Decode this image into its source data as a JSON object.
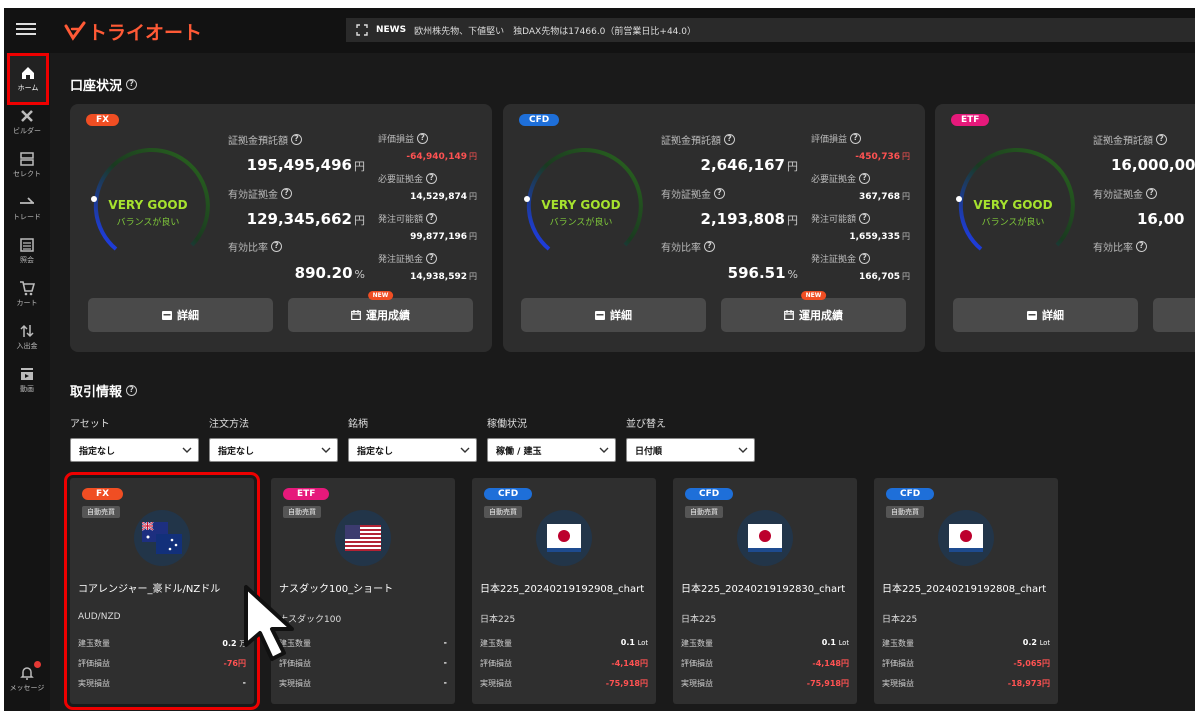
{
  "header": {
    "menu_icon": "hamburger-icon",
    "logo_text": "トライオート",
    "news": {
      "label": "NEWS",
      "text": "欧州株先物、下値堅い　独DAX先物は17466.0（前営業日比+44.0）"
    }
  },
  "sidebar": {
    "items": [
      {
        "label": "ホーム",
        "icon": "home-icon"
      },
      {
        "label": "ビルダー",
        "icon": "tools-icon"
      },
      {
        "label": "セレクト",
        "icon": "select-icon"
      },
      {
        "label": "トレード",
        "icon": "trade-icon"
      },
      {
        "label": "照会",
        "icon": "list-icon"
      },
      {
        "label": "カート",
        "icon": "cart-icon"
      },
      {
        "label": "入出金",
        "icon": "transfer-icon"
      },
      {
        "label": "動画",
        "icon": "video-icon"
      },
      {
        "label": "メッセージ",
        "icon": "bell-icon"
      }
    ]
  },
  "account": {
    "title": "口座状況",
    "cards": [
      {
        "type": "FX",
        "status": "VERY GOOD",
        "status_sub": "バランスが良い",
        "deposit_label": "証拠金預託額",
        "deposit": "195,495,496",
        "effective_label": "有効証拠金",
        "effective": "129,345,662",
        "ratio_label": "有効比率",
        "ratio": "890.20",
        "pl_label": "評価損益",
        "pl": "-64,940,149",
        "req_label": "必要証拠金",
        "req": "14,529,874",
        "order_label": "発注可能額",
        "order": "99,877,196",
        "order_margin_label": "発注証拠金",
        "order_margin": "14,938,592",
        "detail_btn": "詳細",
        "perf_btn": "運用成績",
        "new": "NEW",
        "yen": "円",
        "pct": "%"
      },
      {
        "type": "CFD",
        "status": "VERY GOOD",
        "status_sub": "バランスが良い",
        "deposit_label": "証拠金預託額",
        "deposit": "2,646,167",
        "effective_label": "有効証拠金",
        "effective": "2,193,808",
        "ratio_label": "有効比率",
        "ratio": "596.51",
        "pl_label": "評価損益",
        "pl": "-450,736",
        "req_label": "必要証拠金",
        "req": "367,768",
        "order_label": "発注可能額",
        "order": "1,659,335",
        "order_margin_label": "発注証拠金",
        "order_margin": "166,705",
        "detail_btn": "詳細",
        "perf_btn": "運用成績",
        "new": "NEW",
        "yen": "円",
        "pct": "%"
      },
      {
        "type": "ETF",
        "status": "VERY GOOD",
        "status_sub": "バランスが良い",
        "deposit_label": "証拠金預託額",
        "deposit": "16,000,00",
        "effective_label": "有効証拠金",
        "effective": "16,00",
        "ratio_label": "有効比率",
        "detail_btn": "詳細"
      }
    ]
  },
  "trade": {
    "title": "取引情報",
    "filters": [
      {
        "label": "アセット",
        "value": "指定なし"
      },
      {
        "label": "注文方法",
        "value": "指定なし"
      },
      {
        "label": "銘柄",
        "value": "指定なし"
      },
      {
        "label": "稼働状況",
        "value": "稼働 / 建玉"
      },
      {
        "label": "並び替え",
        "value": "日付順"
      }
    ],
    "row_labels": {
      "qty": "建玉数量",
      "pl": "評価損益",
      "realized": "実現損益"
    },
    "cards": [
      {
        "type": "FX",
        "mode": "自動売買",
        "name": "コアレンジャー_豪ドル/NZドル",
        "symbol": "AUD/NZD",
        "qty": "0.2",
        "qty_unit": "万",
        "pl": "-76",
        "pl_unit": "円",
        "realized": "-",
        "realized_unit": "",
        "flag": "au-nz-flag"
      },
      {
        "type": "ETF",
        "mode": "自動売買",
        "name": "ナスダック100_ショート",
        "symbol": "ナスダック100",
        "qty": "-",
        "qty_unit": "",
        "pl": "-",
        "pl_unit": "",
        "realized": "-",
        "realized_unit": "",
        "flag": "us-flag"
      },
      {
        "type": "CFD",
        "mode": "自動売買",
        "name": "日本225_20240219192908_chart",
        "symbol": "日本225",
        "qty": "0.1",
        "qty_unit": "Lot",
        "pl": "-4,148",
        "pl_unit": "円",
        "realized": "-75,918",
        "realized_unit": "円",
        "flag": "jp-flag"
      },
      {
        "type": "CFD",
        "mode": "自動売買",
        "name": "日本225_20240219192830_chart",
        "symbol": "日本225",
        "qty": "0.1",
        "qty_unit": "Lot",
        "pl": "-4,148",
        "pl_unit": "円",
        "realized": "-75,918",
        "realized_unit": "円",
        "flag": "jp-flag"
      },
      {
        "type": "CFD",
        "mode": "自動売買",
        "name": "日本225_20240219192808_chart",
        "symbol": "日本225",
        "qty": "0.2",
        "qty_unit": "Lot",
        "pl": "-5,065",
        "pl_unit": "円",
        "realized": "-18,973",
        "realized_unit": "円",
        "flag": "jp-flag"
      }
    ]
  },
  "colors": {
    "fx": "#f04e23",
    "cfd": "#1e6fd9",
    "etf": "#e6197b",
    "negative": "#ff5252",
    "highlight": "#e00000"
  }
}
